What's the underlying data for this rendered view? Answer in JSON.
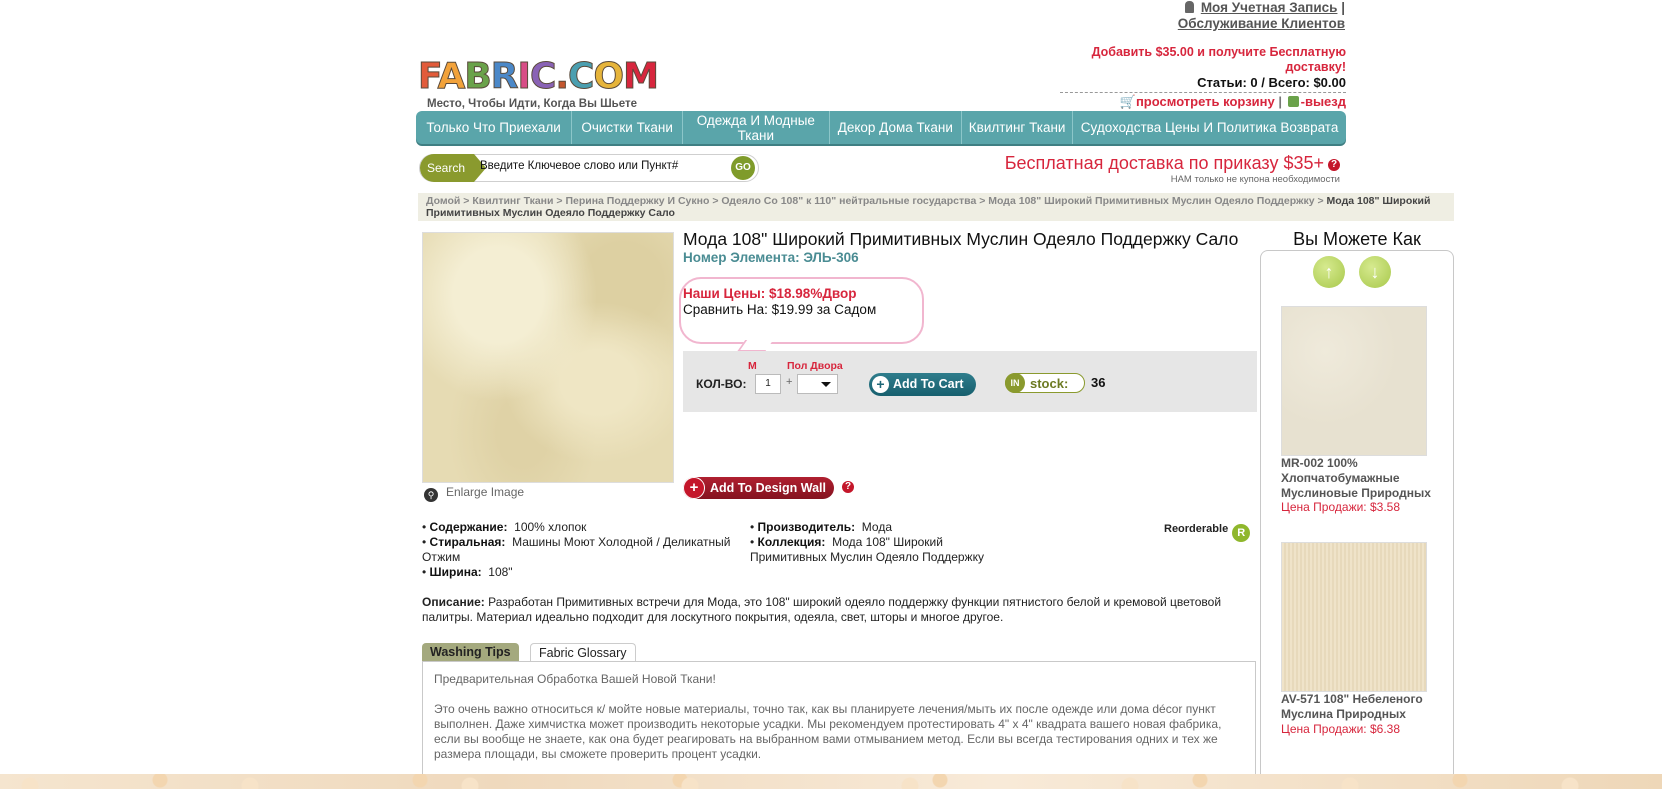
{
  "header": {
    "account_link": "Моя Учетная Запись",
    "separator": "|",
    "service_link": "Обслуживание Клиентов",
    "logo_text": "FABRIC.COM",
    "tagline": "Место, Чтобы Идти, Когда Вы Шьете",
    "promo": "Добавить $35.00 и получите Бесплатную доставку!",
    "cart_summary": "Статьи: 0 / Всего: $0.00",
    "view_cart": "просмотреть корзину",
    "checkout": "-выезд"
  },
  "nav": {
    "items": [
      {
        "label": "Только Что Приехали"
      },
      {
        "label": "Очистки Ткани"
      },
      {
        "label": "Одежда И Модные Ткани"
      },
      {
        "label": "Декор Дома Ткани"
      },
      {
        "label": "Квилтинг Ткани"
      },
      {
        "label": "Судоходства Цены И Политика Возврата"
      }
    ]
  },
  "search": {
    "tag": "Search",
    "placeholder": "Введите Ключевое слово или Пункт#",
    "go_label": "GO"
  },
  "shipping": {
    "free": "Бесплатная доставка по приказу $35+",
    "note": "НАМ только не купона необходимости"
  },
  "breadcrumb": {
    "path": "Домой > Квилтинг Ткани > Перина Поддержку И Сукно > Одеяло Со 108\" к 110\" нейтральные государства > Мода 108\" Широкий Примитивных Муслин Одеяло Поддержку >",
    "current": "Мода 108\" Широкий Примитивных Муслин Одеяло Поддержку Сало"
  },
  "product": {
    "enlarge": "Enlarge Image",
    "title": "Мода 108\" Широкий Примитивных Муслин Одеяло Поддержку Сало",
    "item_number": "Номер Элемента: ЭЛЬ-306",
    "our_price": "Наши Цены: $18.98%Двор",
    "compare": "Сравнить На: $19.99 за Садом",
    "qty_label": "КОЛ-ВО:",
    "unit_m": "М",
    "unit_half": "Пол Двора",
    "qty_value": "1",
    "plus": "+",
    "add_to_cart": "Add To Cart",
    "stock_label": "stock:",
    "stock_count": "36",
    "add_design_wall": "Add To Design Wall",
    "help": "?"
  },
  "details": {
    "content_label": "Содержание:",
    "content": "100% хлопок",
    "washing_label": "Стиральная:",
    "washing": "Машины Моют Холодной / Деликатный Отжим",
    "width_label": "Ширина:",
    "width": "108\"",
    "maker_label": "Производитель:",
    "maker": "Мода",
    "collection_label": "Коллекция:",
    "collection": "Мода 108\" Широкий Примитивных Муслин Одеяло Поддержку",
    "reorderable": "Reorderable",
    "reorder_badge": "R",
    "desc_label": "Описание:",
    "desc": "Разработан Примитивных встречи для Мода, это 108\" широкий одеяло поддержку функции пятнистого белой и кремовой цветовой палитры. Материал идеально подходит для лоскутного покрытия, одеяла, свет, шторы и многое другое."
  },
  "tabs": {
    "washing_tips": "Washing Tips",
    "glossary": "Fabric Glossary",
    "panel_p1": "Предварительная Обработка Вашей Новой Ткани!",
    "panel_p2": "Это очень важно относиться к/ мойте новые материалы, точно так, как вы планируете лечения/мыть их после одежде или дома décor пункт выполнен. Даже химчистка может производить некоторые усадки. Мы рекомендуем протестировать 4\" x 4\" квадрата вашего новая фабрика, если вы вообще не знаете, как она будет реагировать на выбранном вами отмыванием метод. Если вы всегда тестирования одних и тех же размера площади, вы сможете проверить процент усадки."
  },
  "sidebar": {
    "title": "Вы Можете Как",
    "items": [
      {
        "name": "MR-002 100% Хлопчатобумажные Муслиновые Природных",
        "price": "Цена Продажи: $3.58"
      },
      {
        "name": "AV-571 108\" Небеленого Муслина Природных",
        "price": "Цена Продажи: $6.38"
      }
    ]
  },
  "colors": {
    "nav_bg": "#5aa5aa",
    "accent_red": "#d7263d",
    "item_teal": "#4a8c93",
    "search_olive": "#8a9a2e"
  }
}
